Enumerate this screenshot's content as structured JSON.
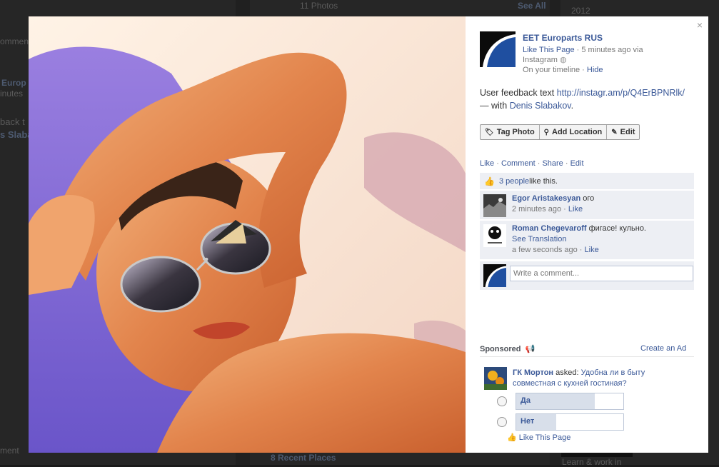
{
  "background": {
    "photos_label": "11 Photos",
    "see_all": "See All",
    "year": "2012",
    "comment_fragment": "omment",
    "europarts_fragment": "Europ",
    "minutes_fragment": "inutes",
    "feedback_fragment": "back t",
    "slabak_fragment": "s Slaba",
    "recent_places": "8 Recent Places",
    "learn_work": "Learn & work in",
    "bottom_comment": "ment"
  },
  "poster": {
    "name": "EET Europarts RUS",
    "like_page": "Like This Page",
    "time": "5 minutes ago via",
    "source": "Instagram",
    "timeline": "On your timeline",
    "hide": "Hide"
  },
  "caption": {
    "text": "User feedback text ",
    "link": "http://instagr.am/p/Q4ErBPNRlk/",
    "with": " — with ",
    "tagged": "Denis Slabakov",
    "end": "."
  },
  "actions": {
    "tag_photo": "Tag Photo",
    "add_location": "Add Location",
    "edit": "Edit"
  },
  "ufi": {
    "like": "Like",
    "comment": "Comment",
    "share": "Share",
    "edit": "Edit",
    "sep": " · ",
    "likes_count": "3 people",
    "likes_suffix": " like this."
  },
  "comments": [
    {
      "author": "Egor Aristakesyan",
      "text": " ого",
      "translation": "",
      "time": "2 minutes ago",
      "like": "Like"
    },
    {
      "author": "Roman Chegevaroff",
      "text": " фигасе! кульно.",
      "translation": "See Translation",
      "time": "a few seconds ago",
      "like": "Like"
    }
  ],
  "write_comment": {
    "placeholder": "Write a comment..."
  },
  "sponsored": {
    "label": "Sponsored",
    "create_ad": "Create an Ad",
    "author": "ГК Мортон",
    "asked": " asked: ",
    "question": "Удобна ли в быту совместная с кухней гостиная?",
    "options": [
      {
        "label": "Да",
        "fraction": 0.73
      },
      {
        "label": "Нет",
        "fraction": 0.37
      }
    ],
    "like_page": "Like This Page"
  },
  "close": "×",
  "colors": {
    "link": "#3b5998",
    "panel_bg": "#edeff4",
    "logo_blue": "#1f4fa0"
  }
}
